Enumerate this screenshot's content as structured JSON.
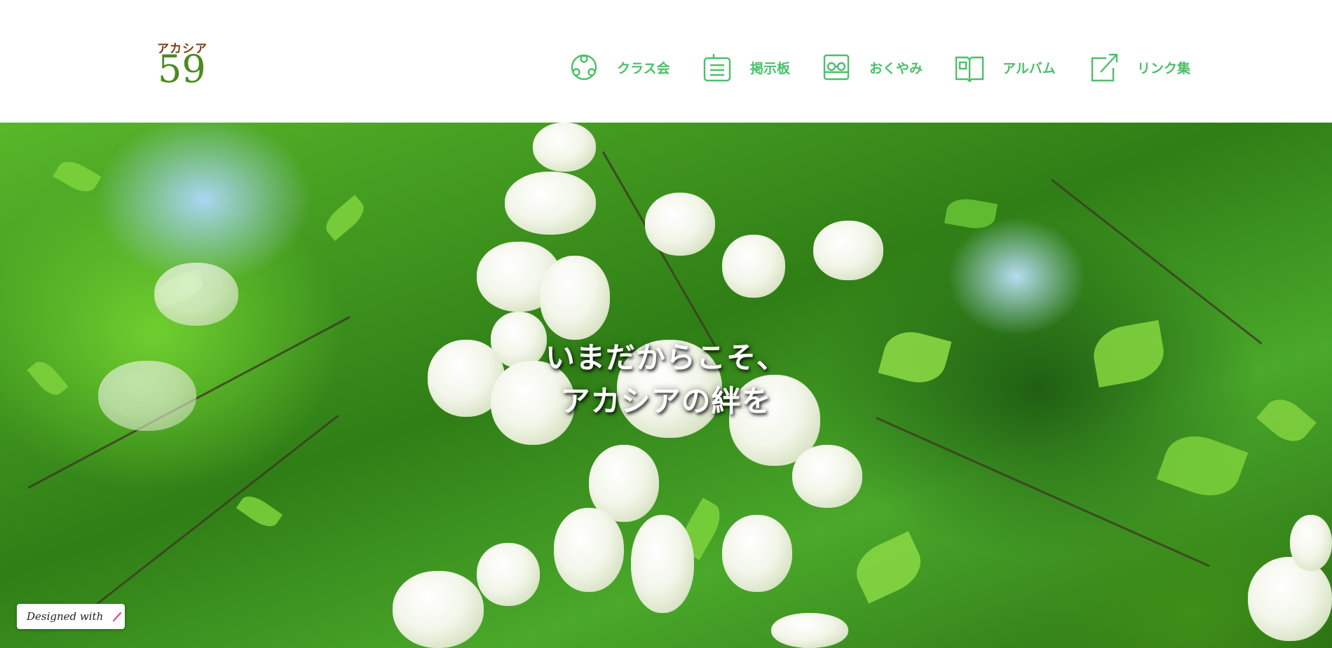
{
  "logo": {
    "kana": "アカシア",
    "number": "59"
  },
  "nav": [
    {
      "label": "クラス会",
      "icon": "people-circle-icon"
    },
    {
      "label": "掲示板",
      "icon": "bulletin-board-icon"
    },
    {
      "label": "おくやみ",
      "icon": "condolence-glasses-icon"
    },
    {
      "label": "アルバム",
      "icon": "album-book-icon"
    },
    {
      "label": "リンク集",
      "icon": "external-link-icon"
    }
  ],
  "hero": {
    "line1": "いまだからこそ、",
    "line2": "アカシアの絆を"
  },
  "badge": {
    "text": "Designed with",
    "icon": "pen-icon"
  },
  "colors": {
    "accent": "#4cbf6a",
    "logo_brown": "#7a3f12",
    "logo_green": "#4c8a1f"
  }
}
